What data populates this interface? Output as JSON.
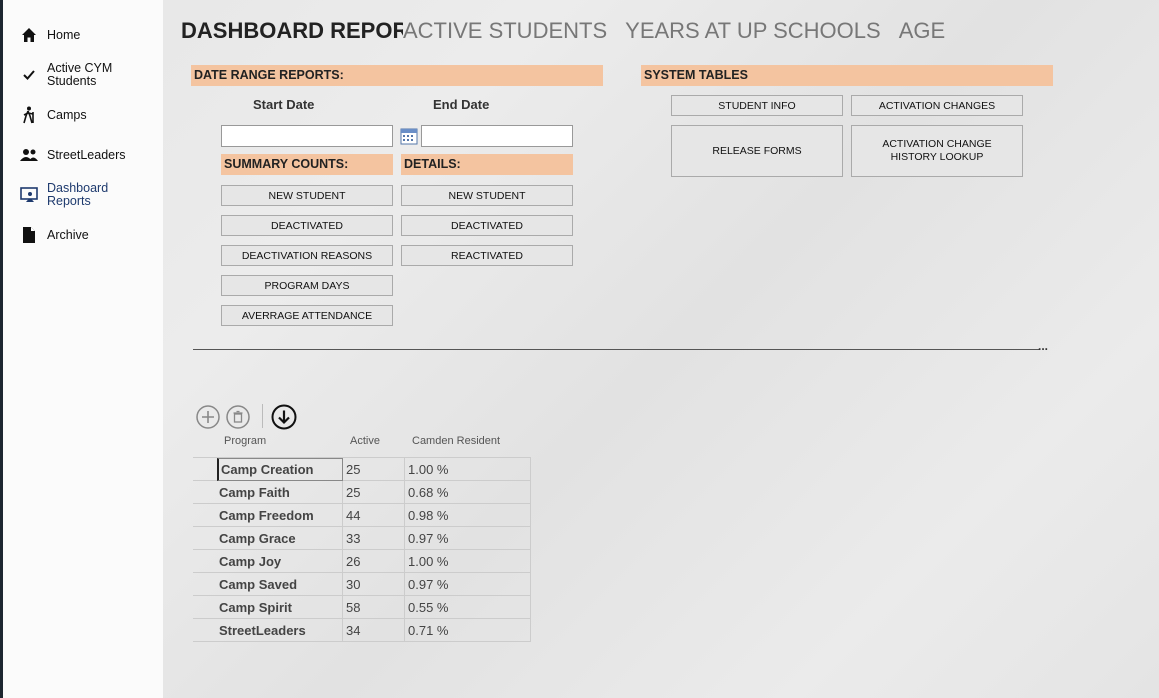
{
  "sidebar": {
    "items": [
      {
        "label_lines": [
          "Home"
        ],
        "icon": "home-icon"
      },
      {
        "label_lines": [
          "Active CYM",
          "Students"
        ],
        "icon": "check-icon"
      },
      {
        "label_lines": [
          "Camps"
        ],
        "icon": "hiker-icon"
      },
      {
        "label_lines": [
          "StreetLeaders"
        ],
        "icon": "people-icon"
      },
      {
        "label_lines": [
          "Dashboard",
          "Reports"
        ],
        "icon": "dashboard-icon"
      },
      {
        "label_lines": [
          "Archive"
        ],
        "icon": "document-icon"
      }
    ]
  },
  "header": {
    "title": "DASHBOARD REPORTS",
    "tabs": [
      "ACTIVE STUDENTS",
      "YEARS AT UP SCHOOLS",
      "AGE"
    ]
  },
  "date_range": {
    "heading": "DATE RANGE REPORTS:",
    "start_label": "Start Date",
    "end_label": "End Date",
    "start_value": "",
    "end_value": ""
  },
  "summary": {
    "heading": "SUMMARY COUNTS:",
    "buttons": [
      "NEW STUDENT",
      "DEACTIVATED",
      "DEACTIVATION REASONS",
      "PROGRAM DAYS",
      "AVERRAGE ATTENDANCE"
    ]
  },
  "details": {
    "heading": "DETAILS:",
    "buttons": [
      "NEW STUDENT",
      "DEACTIVATED",
      "REACTIVATED"
    ]
  },
  "system_tables": {
    "heading": "SYSTEM TABLES",
    "buttons": [
      "STUDENT INFO",
      "ACTIVATION CHANGES",
      "RELEASE FORMS",
      "ACTIVATION CHANGE HISTORY LOOKUP"
    ]
  },
  "divider_ellipsis": "...",
  "toolbar": {
    "icons": [
      "add-icon",
      "delete-icon",
      "download-icon"
    ]
  },
  "table": {
    "headers": [
      "Program",
      "Active",
      "Camden Resident"
    ],
    "rows": [
      [
        "Camp Creation",
        "25",
        "1.00 %"
      ],
      [
        "Camp Faith",
        "25",
        "0.68 %"
      ],
      [
        "Camp Freedom",
        "44",
        "0.98 %"
      ],
      [
        "Camp Grace",
        "33",
        "0.97 %"
      ],
      [
        "Camp Joy",
        "26",
        "1.00 %"
      ],
      [
        "Camp Saved",
        "30",
        "0.97 %"
      ],
      [
        "Camp Spirit",
        "58",
        "0.55 %"
      ],
      [
        "StreetLeaders",
        "34",
        "0.71 %"
      ]
    ]
  },
  "colors": {
    "section_accent": "#f4c4a0",
    "active_nav": "#1e3a6e"
  }
}
